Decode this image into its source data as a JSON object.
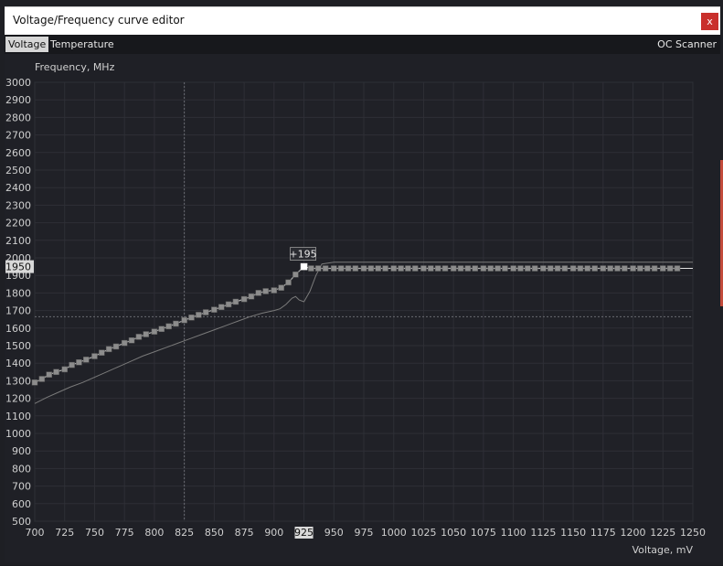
{
  "window": {
    "title": "Voltage/Frequency curve editor",
    "close_glyph": "x"
  },
  "tabs": [
    {
      "label": "Voltage",
      "active": true
    },
    {
      "label": "Temperature",
      "active": false
    }
  ],
  "oc_scanner_label": "OC Scanner",
  "colors": {
    "background": "#1f2026",
    "grid": "#2e2f36",
    "axis_text": "#cfcfcf",
    "curve": "#b0b0b0",
    "base_curve": "#7a7a7a",
    "accent_strip": "#c24a3a"
  },
  "chart_data": {
    "type": "line",
    "ylabel": "Frequency, MHz",
    "xlabel": "Voltage, mV",
    "xlim": [
      700,
      1250
    ],
    "ylim": [
      500,
      3000
    ],
    "xticks": [
      700,
      725,
      750,
      775,
      800,
      825,
      850,
      875,
      900,
      925,
      950,
      975,
      1000,
      1025,
      1050,
      1075,
      1100,
      1125,
      1150,
      1175,
      1200,
      1225,
      1250
    ],
    "yticks": [
      500,
      600,
      700,
      800,
      900,
      1000,
      1100,
      1200,
      1300,
      1400,
      1500,
      1600,
      1700,
      1800,
      1900,
      2000,
      2100,
      2200,
      2300,
      2400,
      2500,
      2600,
      2700,
      2800,
      2900,
      3000
    ],
    "grid": true,
    "cursor": {
      "voltage": 825,
      "frequency": 1665
    },
    "selected_point": {
      "voltage": 925,
      "frequency": 1950,
      "offset_label": "+195",
      "x_label": "925",
      "y_label": "1950"
    },
    "series": [
      {
        "role": "adjusted",
        "points": [
          [
            700,
            1290
          ],
          [
            706,
            1310
          ],
          [
            712,
            1335
          ],
          [
            718,
            1350
          ],
          [
            725,
            1365
          ],
          [
            731,
            1390
          ],
          [
            737,
            1405
          ],
          [
            743,
            1420
          ],
          [
            750,
            1440
          ],
          [
            756,
            1460
          ],
          [
            762,
            1480
          ],
          [
            768,
            1495
          ],
          [
            775,
            1515
          ],
          [
            781,
            1530
          ],
          [
            787,
            1550
          ],
          [
            793,
            1565
          ],
          [
            800,
            1580
          ],
          [
            806,
            1595
          ],
          [
            812,
            1610
          ],
          [
            818,
            1625
          ],
          [
            825,
            1645
          ],
          [
            831,
            1660
          ],
          [
            837,
            1675
          ],
          [
            843,
            1690
          ],
          [
            850,
            1705
          ],
          [
            856,
            1720
          ],
          [
            862,
            1735
          ],
          [
            868,
            1750
          ],
          [
            875,
            1765
          ],
          [
            881,
            1780
          ],
          [
            887,
            1800
          ],
          [
            893,
            1810
          ],
          [
            900,
            1815
          ],
          [
            906,
            1830
          ],
          [
            912,
            1860
          ],
          [
            918,
            1905
          ],
          [
            925,
            1950
          ],
          [
            931,
            1940
          ],
          [
            937,
            1940
          ],
          [
            943,
            1940
          ],
          [
            950,
            1940
          ],
          [
            956,
            1940
          ],
          [
            962,
            1940
          ],
          [
            968,
            1940
          ],
          [
            975,
            1940
          ],
          [
            981,
            1940
          ],
          [
            987,
            1940
          ],
          [
            993,
            1940
          ],
          [
            1000,
            1940
          ],
          [
            1006,
            1940
          ],
          [
            1012,
            1940
          ],
          [
            1018,
            1940
          ],
          [
            1025,
            1940
          ],
          [
            1031,
            1940
          ],
          [
            1037,
            1940
          ],
          [
            1043,
            1940
          ],
          [
            1050,
            1940
          ],
          [
            1056,
            1940
          ],
          [
            1062,
            1940
          ],
          [
            1068,
            1940
          ],
          [
            1075,
            1940
          ],
          [
            1081,
            1940
          ],
          [
            1087,
            1940
          ],
          [
            1093,
            1940
          ],
          [
            1100,
            1940
          ],
          [
            1106,
            1940
          ],
          [
            1112,
            1940
          ],
          [
            1118,
            1940
          ],
          [
            1125,
            1940
          ],
          [
            1131,
            1940
          ],
          [
            1137,
            1940
          ],
          [
            1143,
            1940
          ],
          [
            1150,
            1940
          ],
          [
            1156,
            1940
          ],
          [
            1162,
            1940
          ],
          [
            1168,
            1940
          ],
          [
            1175,
            1940
          ],
          [
            1181,
            1940
          ],
          [
            1187,
            1940
          ],
          [
            1193,
            1940
          ],
          [
            1200,
            1940
          ],
          [
            1206,
            1940
          ],
          [
            1212,
            1940
          ],
          [
            1218,
            1940
          ],
          [
            1225,
            1940
          ],
          [
            1231,
            1940
          ],
          [
            1237,
            1940
          ]
        ]
      },
      {
        "role": "base",
        "points": [
          [
            700,
            1170
          ],
          [
            710,
            1205
          ],
          [
            720,
            1235
          ],
          [
            730,
            1265
          ],
          [
            740,
            1290
          ],
          [
            750,
            1320
          ],
          [
            760,
            1350
          ],
          [
            770,
            1380
          ],
          [
            780,
            1410
          ],
          [
            790,
            1440
          ],
          [
            800,
            1465
          ],
          [
            810,
            1490
          ],
          [
            820,
            1515
          ],
          [
            830,
            1540
          ],
          [
            840,
            1565
          ],
          [
            850,
            1590
          ],
          [
            860,
            1615
          ],
          [
            870,
            1640
          ],
          [
            880,
            1665
          ],
          [
            890,
            1685
          ],
          [
            900,
            1700
          ],
          [
            905,
            1710
          ],
          [
            910,
            1735
          ],
          [
            915,
            1770
          ],
          [
            918,
            1780
          ],
          [
            921,
            1760
          ],
          [
            925,
            1750
          ],
          [
            930,
            1810
          ],
          [
            935,
            1900
          ],
          [
            940,
            1965
          ],
          [
            950,
            1975
          ],
          [
            1000,
            1975
          ],
          [
            1100,
            1975
          ],
          [
            1200,
            1975
          ],
          [
            1250,
            1975
          ]
        ]
      }
    ]
  }
}
